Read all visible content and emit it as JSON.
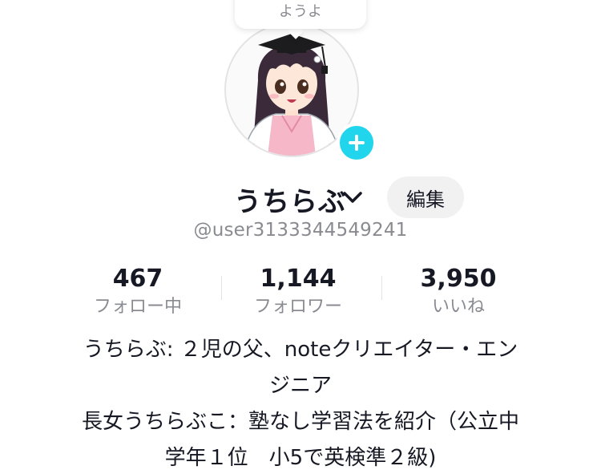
{
  "bubble": {
    "text": "ようよ"
  },
  "profile": {
    "display_name": "うちらぶ",
    "edit_label": "編集",
    "username": "@user3133344549241"
  },
  "stats": [
    {
      "value": "467",
      "label": "フォロー中"
    },
    {
      "value": "1,144",
      "label": "フォロワー"
    },
    {
      "value": "3,950",
      "label": "いいね"
    }
  ],
  "bio": {
    "lines": [
      "うちらぶ: ２児の父、noteクリエイター・エン",
      "ジニア",
      "長女うちらぶこ：塾なし学習法を紹介（公立中",
      "学年１位　小5で英検準２級)"
    ]
  },
  "colors": {
    "accent": "#20d5ec",
    "text_primary": "#161823",
    "text_secondary": "#8a8b91",
    "button_bg": "#f1f1f2"
  },
  "icons": {
    "add": "plus-icon",
    "dropdown": "chevron-down-icon"
  }
}
